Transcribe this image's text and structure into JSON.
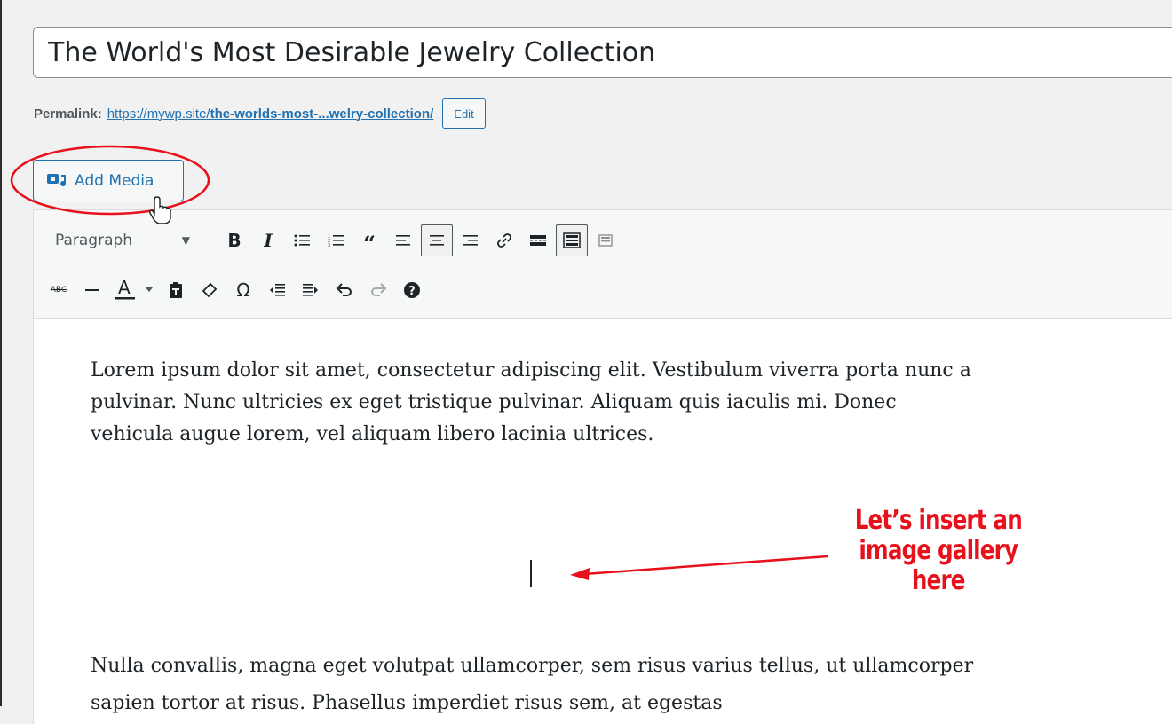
{
  "post": {
    "title": "The World's Most Desirable Jewelry Collection"
  },
  "permalink": {
    "label": "Permalink:",
    "url_base": "https://mywp.site/",
    "slug": "the-worlds-most-...welry-collection/",
    "edit_label": "Edit"
  },
  "add_media": {
    "label": "Add Media"
  },
  "toolbar": {
    "format_selected": "Paragraph",
    "row1": [
      "bold-icon",
      "italic-icon",
      "bulleted-list-icon",
      "numbered-list-icon",
      "blockquote-icon",
      "align-left-icon",
      "align-center-icon",
      "align-right-icon",
      "link-icon",
      "read-more-icon",
      "toolbar-toggle-icon",
      "distraction-free-icon"
    ],
    "row2": [
      "strikethrough-icon",
      "horizontal-line-icon",
      "text-color-icon",
      "paste-as-text-icon",
      "clear-formatting-icon",
      "special-character-icon",
      "decrease-indent-icon",
      "increase-indent-icon",
      "undo-icon",
      "redo-icon",
      "help-icon"
    ]
  },
  "content": {
    "paragraph1": "Lorem ipsum dolor sit amet, consectetur adipiscing elit. Vestibulum viverra porta nunc a pulvinar. Nunc ultricies ex eget tristique pulvinar. Aliquam quis iaculis mi. Donec vehicula augue lorem, vel aliquam libero lacinia ultrices.",
    "paragraph2": "Nulla convallis, magna eget volutpat ullamcorper, sem risus varius tellus, ut ullamcorper sapien tortor at risus. Phasellus imperdiet risus sem, at egestas"
  },
  "annotation": {
    "line1": "Let’s insert an",
    "line2": "image gallery here",
    "color": "#e8101a"
  }
}
